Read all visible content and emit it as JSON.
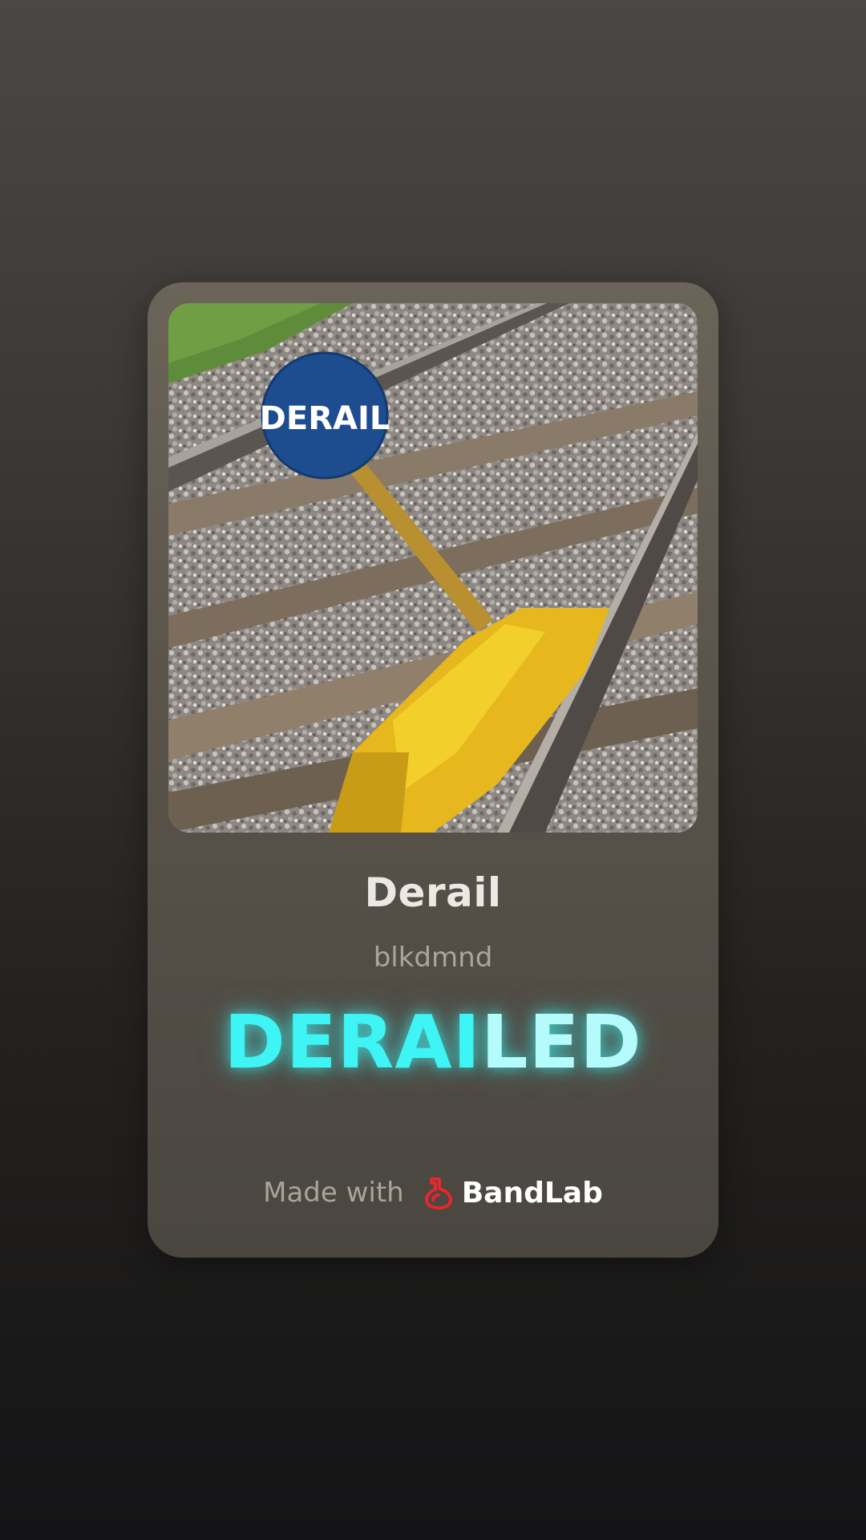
{
  "card": {
    "cover_sign_text": "DERAIL",
    "title": "Derail",
    "artist": "blkdmnd",
    "lyric": {
      "highlighted": "DERAI",
      "rest": "LED"
    },
    "footer": {
      "made_with": "Made with",
      "brand": "BandLab"
    }
  },
  "colors": {
    "lyric_highlight": "#3ef4f4",
    "brand_logo": "#e8262b"
  },
  "icons": [
    "bandlab-logo-icon"
  ]
}
